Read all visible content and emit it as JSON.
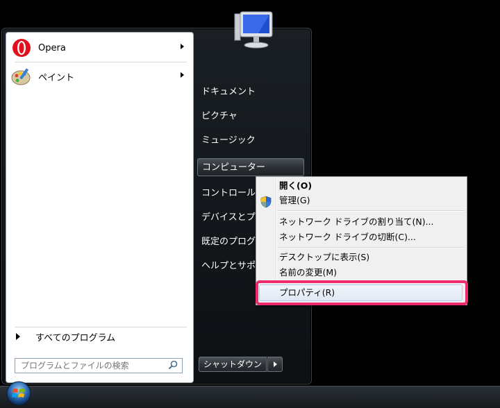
{
  "left_panel": {
    "programs": [
      {
        "label": "Opera",
        "icon": "opera-icon",
        "has_submenu": true
      },
      {
        "label": "ペイント",
        "icon": "paint-icon",
        "has_submenu": true
      }
    ],
    "all_programs": "すべてのプログラム",
    "search_placeholder": "プログラムとファイルの検索"
  },
  "right_panel": {
    "items": [
      "ドキュメント",
      "ピクチャ",
      "ミュージック",
      "コンピューター",
      "コントロール",
      "デバイスとプリ",
      "既定のプログラ",
      "ヘルプとサポー"
    ],
    "highlighted_item": "コンピューター",
    "shutdown_label": "シャットダウン"
  },
  "context_menu": {
    "items": [
      "開く(O)",
      "管理(G)",
      "ネットワーク ドライブの割り当て(N)...",
      "ネットワーク ドライブの切断(C)...",
      "デスクトップに表示(S)",
      "名前の変更(M)",
      "プロパティ(R)"
    ],
    "default_item": "開く(O)",
    "hovered_item": "プロパティ(R)",
    "highlight_color": "#ee2a6f"
  }
}
